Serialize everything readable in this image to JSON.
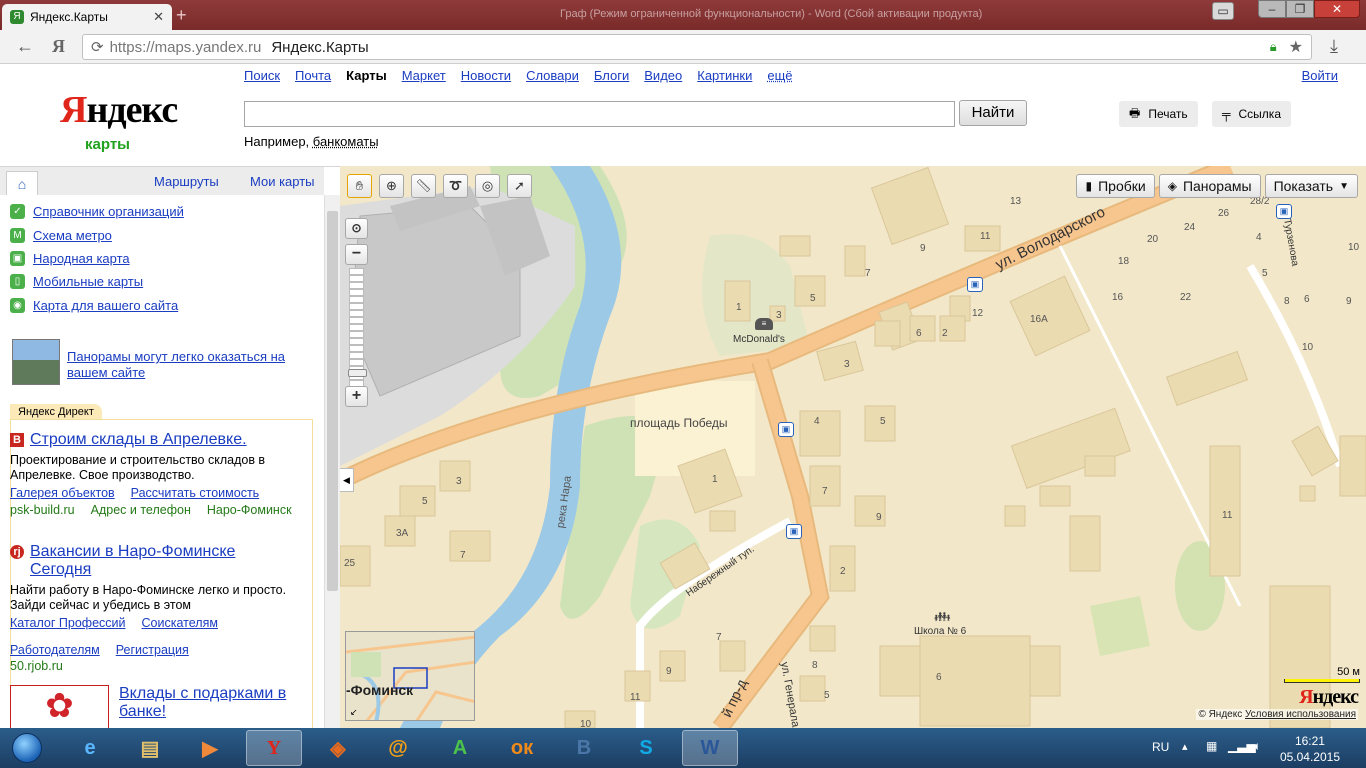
{
  "browser": {
    "tab_title": "Яндекс.Карты",
    "url": "https://maps.yandex.ru",
    "page_title": "Яндекс.Карты",
    "window_title": "Граф (Режим ограниченной функциональности) - Word (Сбой активации продукта)"
  },
  "header": {
    "logo": "Яндекс",
    "logo_first_letter": "Я",
    "logo_rest": "ндекс",
    "logo_sub": "карты",
    "services": [
      "Поиск",
      "Почта",
      "Карты",
      "Маркет",
      "Новости",
      "Словари",
      "Блоги",
      "Видео",
      "Картинки",
      "ещё"
    ],
    "login": "Войти",
    "search_button": "Найти",
    "example_prefix": "Например,",
    "example_link": "банкоматы",
    "print_button": "Печать",
    "link_button": "Ссылка"
  },
  "sidebar": {
    "tabs": {
      "routes": "Маршруты",
      "my_maps": "Мои карты"
    },
    "links": [
      "Справочник организаций",
      "Схема метро",
      "Народная карта",
      "Мобильные карты",
      "Карта для вашего сайта"
    ],
    "panorama_promo": "Панорамы могут легко оказаться на вашем сайте",
    "direct_label": "Яндекс Директ",
    "ads": [
      {
        "title": "Строим склады в Апрелевке.",
        "text": "Проектирование и строительство складов в Апрелевке. Свое производство.",
        "links": [
          "Галерея объектов",
          "Рассчитать стоимость"
        ],
        "domain": "psk-build.ru",
        "extra": [
          "Адрес и телефон",
          "Наро-Фоминск"
        ]
      },
      {
        "title": "Вакансии в Наро-Фоминске Сегодня",
        "text": "Найти работу в Наро-Фоминске легко и просто. Зайди сейчас и убедись в этом",
        "links": [
          "Каталог Профессий",
          "Соискателям",
          "Работодателям",
          "Регистрация"
        ],
        "domain": "50.rjob.ru"
      },
      {
        "title": "Вклады с подарками в банке!"
      }
    ]
  },
  "map": {
    "layers": {
      "traffic": "Пробки",
      "panoramas": "Панорамы",
      "show": "Показать"
    },
    "streets": {
      "volodarskogo": "ул. Володарского",
      "naberezhny": "Набережный туп.",
      "gen_efremova": "ул. Генерала Ефре",
      "river": "река Нара",
      "ave": "й пр-д",
      "turzenova": "Турзенова"
    },
    "places": {
      "square": "площадь Победы",
      "mcdonalds": "McDonald's",
      "school": "Школа № 6"
    },
    "house_numbers": [
      "13",
      "9",
      "11",
      "7",
      "5",
      "1",
      "3",
      "20",
      "24",
      "26",
      "28/2",
      "4",
      "5",
      "6",
      "8",
      "9",
      "10",
      "18",
      "16",
      "22",
      "12",
      "16А",
      "10",
      "6",
      "2",
      "3",
      "4",
      "5",
      "7",
      "9",
      "2",
      "1",
      "3",
      "5",
      "3А",
      "7",
      "25",
      "11",
      "6",
      "8",
      "5",
      "7",
      "9",
      "11",
      "10"
    ],
    "minimap_label": "-Фоминск",
    "scale": "50 м",
    "logo": "Яндекс",
    "logo_first_letter": "Я",
    "logo_rest": "ндекс",
    "copyright": "© Яндекс",
    "terms": "Условия использования"
  },
  "taskbar": {
    "language": "RU",
    "time": "16:21",
    "date": "05.04.2015"
  }
}
